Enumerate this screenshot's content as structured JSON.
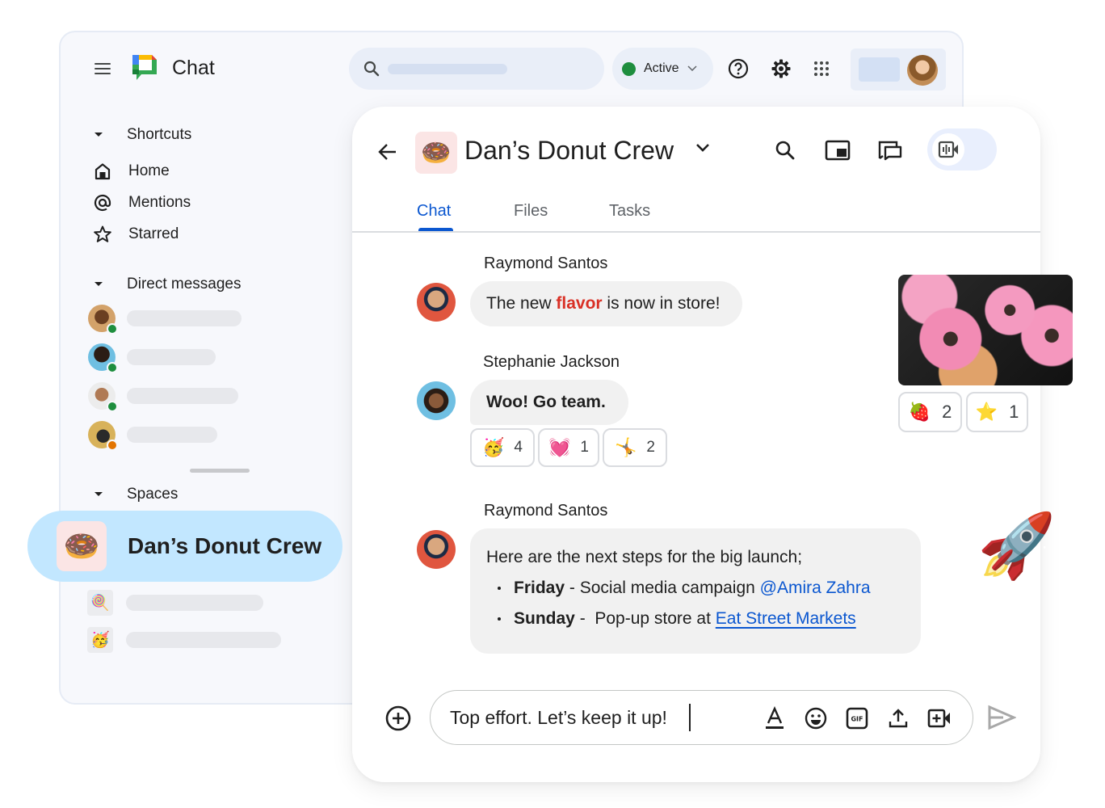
{
  "app": {
    "title": "Chat",
    "status": "Active"
  },
  "topbar": {
    "menu_icon": "hamburger-menu-icon",
    "search_icon": "search-icon",
    "help_icon": "help-circle-icon",
    "settings_icon": "gear-icon",
    "apps_icon": "apps-grid-icon",
    "status_color": "#1e8e3e"
  },
  "sidebar": {
    "shortcuts_label": "Shortcuts",
    "shortcuts": [
      {
        "label": "Home",
        "icon": "home-icon"
      },
      {
        "label": "Mentions",
        "icon": "at-sign-icon"
      },
      {
        "label": "Starred",
        "icon": "star-icon"
      }
    ],
    "dm_label": "Direct messages",
    "direct_messages": [
      {
        "presence": "active"
      },
      {
        "presence": "active"
      },
      {
        "presence": "active"
      },
      {
        "presence": "away"
      }
    ],
    "spaces_label": "Spaces",
    "selected_space": {
      "name": "Dan’s Donut Crew",
      "emoji": "🍩"
    },
    "other_spaces": [
      {
        "emoji": "🍭"
      },
      {
        "emoji": "🥳"
      }
    ]
  },
  "chat": {
    "space_name": "Dan’s Donut Crew",
    "space_emoji": "🍩",
    "tabs": [
      {
        "label": "Chat",
        "active": true
      },
      {
        "label": "Files",
        "active": false
      },
      {
        "label": "Tasks",
        "active": false
      }
    ],
    "messages": [
      {
        "sender": "Raymond Santos",
        "text_before": "The new ",
        "highlight": "flavor",
        "text_after": " is now in store!"
      },
      {
        "sender": "Stephanie Jackson",
        "text": "Woo! Go team.",
        "reactions": [
          {
            "emoji": "🥳",
            "count": "4"
          },
          {
            "emoji": "💓",
            "count": "1"
          },
          {
            "emoji": "🤸",
            "count": "2"
          }
        ]
      },
      {
        "sender": "Raymond Santos",
        "intro": "Here are the next steps for the big launch;",
        "items": [
          {
            "day": "Friday",
            "sep": " - ",
            "text": "Social media campaign ",
            "mention": "@Amira Zahra"
          },
          {
            "day": "Sunday",
            "sep": " -  ",
            "text": "Pop-up store at ",
            "link": "Eat Street Markets"
          }
        ]
      }
    ],
    "photo_reactions": [
      {
        "emoji": "🍓",
        "count": "2"
      },
      {
        "emoji": "⭐",
        "count": "1"
      }
    ],
    "rocket_emoji": "🚀",
    "composer": {
      "value": "Top effort. Let’s keep it up!",
      "tools": [
        "format-text-icon",
        "emoji-icon",
        "gif-icon",
        "upload-icon",
        "add-video-meeting-icon"
      ]
    },
    "accent_color": "#0b57d0",
    "highlight_color": "#d93025"
  }
}
